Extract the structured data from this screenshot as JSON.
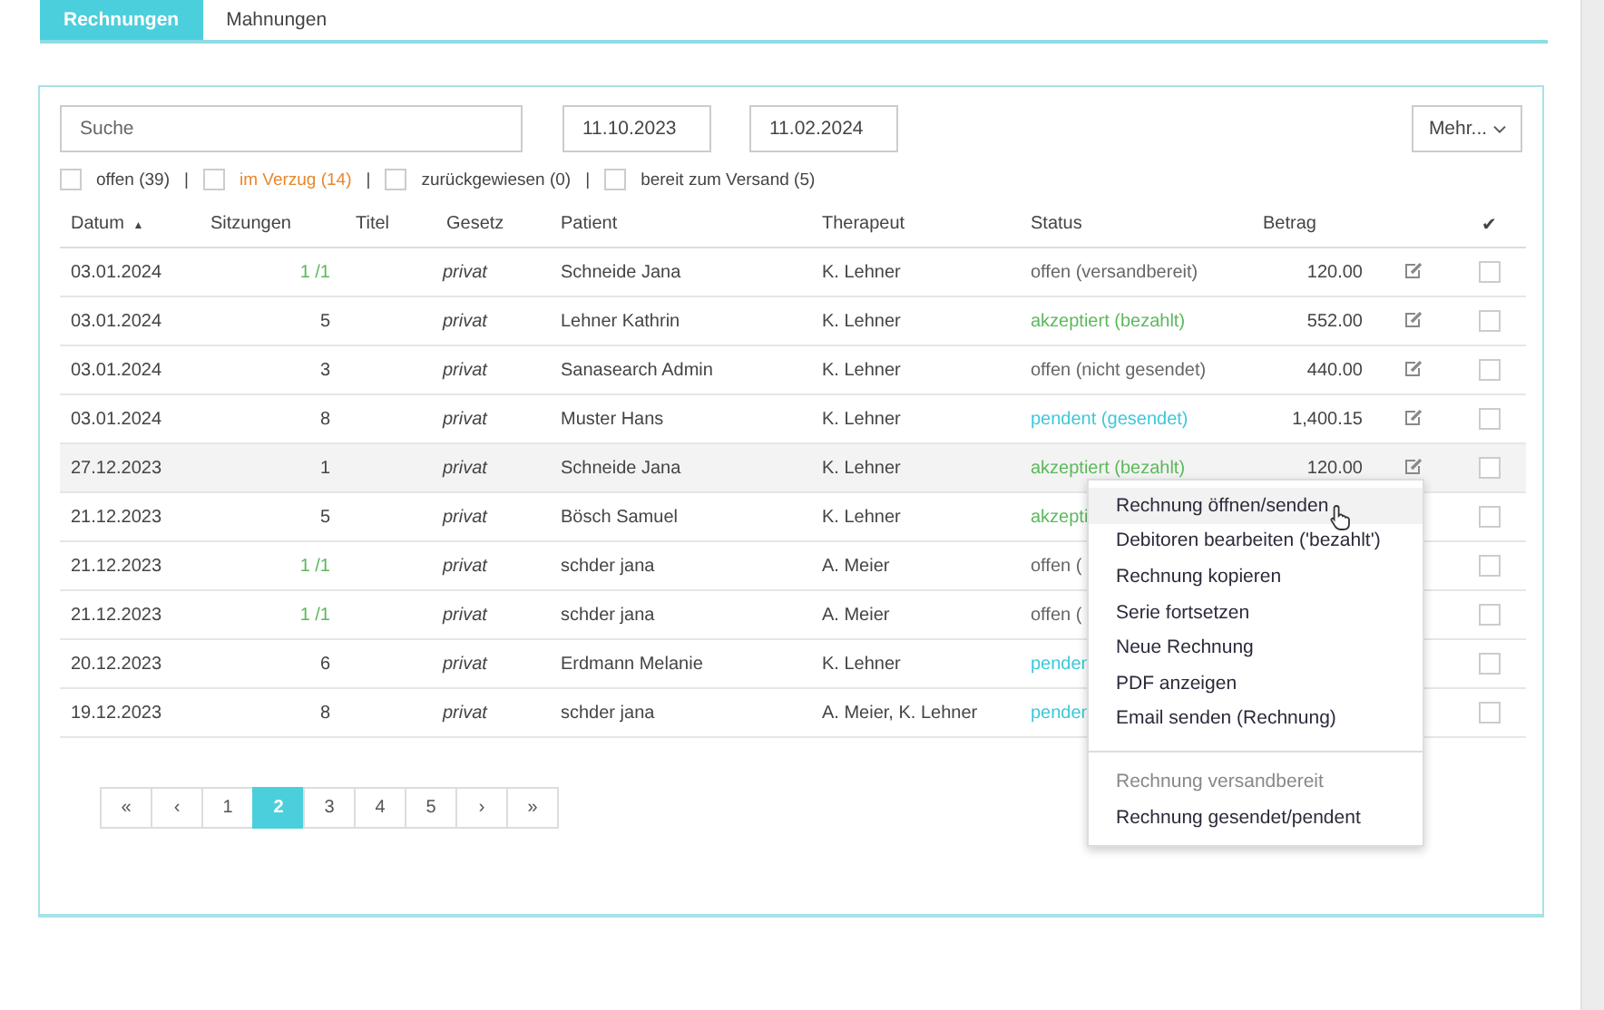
{
  "tabs": [
    {
      "label": "Rechnungen",
      "selected": true
    },
    {
      "label": "Mahnungen",
      "selected": false
    }
  ],
  "search": {
    "placeholder": "Suche"
  },
  "date_from": {
    "value": "11.10.2023"
  },
  "date_to": {
    "value": "11.02.2024"
  },
  "more_button": {
    "label": "Mehr..."
  },
  "filters": [
    {
      "label": "offen (39)",
      "checked": false,
      "highlight": false
    },
    {
      "label": "im Verzug (14)",
      "checked": false,
      "highlight": true
    },
    {
      "label": "zurückgewiesen (0)",
      "checked": false,
      "highlight": false
    },
    {
      "label": "bereit zum Versand (5)",
      "checked": false,
      "highlight": false
    }
  ],
  "separators": [
    "|",
    "|",
    "|"
  ],
  "table": {
    "columns": [
      {
        "label": "Datum",
        "sort_icon": "▲"
      },
      {
        "label": "Sitzungen"
      },
      {
        "label": "Titel"
      },
      {
        "label": "Gesetz"
      },
      {
        "label": "Patient"
      },
      {
        "label": "Therapeut"
      },
      {
        "label": "Status"
      },
      {
        "label": "Betrag"
      },
      {},
      {
        "label": "✔"
      }
    ],
    "rows": [
      {
        "date": "03.01.2024",
        "sessions": "1 /1",
        "series": true,
        "law": "privat",
        "patient": "Schneide Jana",
        "therapist": "K. Lehner",
        "status": "offen (versandbereit)",
        "kind": "open",
        "amount": "120.00",
        "selected": false,
        "checked": false
      },
      {
        "date": "03.01.2024",
        "sessions": "5",
        "series": false,
        "law": "privat",
        "patient": "Lehner Kathrin",
        "therapist": "K. Lehner",
        "status": "akzeptiert (bezahlt)",
        "kind": "paid",
        "amount": "552.00",
        "selected": false,
        "checked": false
      },
      {
        "date": "03.01.2024",
        "sessions": "3",
        "series": false,
        "law": "privat",
        "patient": "Sanasearch Admin",
        "therapist": "K. Lehner",
        "status": "offen (nicht gesendet)",
        "kind": "open",
        "amount": "440.00",
        "selected": false,
        "checked": false
      },
      {
        "date": "03.01.2024",
        "sessions": "8",
        "series": false,
        "law": "privat",
        "patient": "Muster Hans",
        "therapist": "K. Lehner",
        "status": "pendent (gesendet)",
        "kind": "pending",
        "amount": "1,400.15",
        "selected": false,
        "checked": false
      },
      {
        "date": "27.12.2023",
        "sessions": "1",
        "series": false,
        "law": "privat",
        "patient": "Schneide Jana",
        "therapist": "K. Lehner",
        "status": "akzeptiert (bezahlt)",
        "kind": "paid",
        "amount": "120.00",
        "selected": true,
        "checked": false
      },
      {
        "date": "21.12.2023",
        "sessions": "5",
        "series": false,
        "law": "privat",
        "patient": "Bösch Samuel",
        "therapist": "K. Lehner",
        "status": "akzepti",
        "kind": "paid",
        "selected": false,
        "checked": false
      },
      {
        "date": "21.12.2023",
        "sessions": "1 /1",
        "series": true,
        "law": "privat",
        "patient": "schder jana",
        "therapist": "A. Meier",
        "status": "offen (",
        "kind": "open",
        "selected": false,
        "checked": false
      },
      {
        "date": "21.12.2023",
        "sessions": "1 /1",
        "series": true,
        "law": "privat",
        "patient": "schder jana",
        "therapist": "A. Meier",
        "status": "offen (",
        "kind": "open",
        "selected": false,
        "checked": false
      },
      {
        "date": "20.12.2023",
        "sessions": "6",
        "series": false,
        "law": "privat",
        "patient": "Erdmann Melanie",
        "therapist": "K. Lehner",
        "status": "penden",
        "kind": "pending",
        "selected": false,
        "checked": false
      },
      {
        "date": "19.12.2023",
        "sessions": "8",
        "series": false,
        "law": "privat",
        "patient": "schder jana",
        "therapist": "A. Meier, K. Lehner",
        "status": "penden",
        "kind": "pending",
        "selected": false,
        "checked": false
      }
    ]
  },
  "pagination": [
    {
      "label": "«",
      "selected": false
    },
    {
      "label": "‹",
      "selected": false
    },
    {
      "label": "1",
      "selected": false
    },
    {
      "label": "2",
      "selected": true
    },
    {
      "label": "3",
      "selected": false
    },
    {
      "label": "4",
      "selected": false
    },
    {
      "label": "5",
      "selected": false
    },
    {
      "label": "›",
      "selected": false
    },
    {
      "label": "»",
      "selected": false
    }
  ],
  "context_menu": {
    "groups": [
      [
        {
          "label": "Rechnung öffnen/senden",
          "selected": true,
          "disabled": false
        },
        {
          "label": "Debitoren bearbeiten ('bezahlt')",
          "selected": false,
          "disabled": false
        },
        {
          "label": "Rechnung kopieren",
          "selected": false,
          "disabled": false
        },
        {
          "label": "Serie fortsetzen",
          "selected": false,
          "disabled": false
        },
        {
          "label": "Neue Rechnung",
          "selected": false,
          "disabled": false
        },
        {
          "label": "PDF anzeigen",
          "selected": false,
          "disabled": false
        },
        {
          "label": "Email senden (Rechnung)",
          "selected": false,
          "disabled": false
        }
      ],
      [
        {
          "label": "Rechnung versandbereit",
          "selected": false,
          "disabled": true
        },
        {
          "label": "Rechnung gesendet/pendent",
          "selected": false,
          "disabled": false
        }
      ]
    ]
  }
}
